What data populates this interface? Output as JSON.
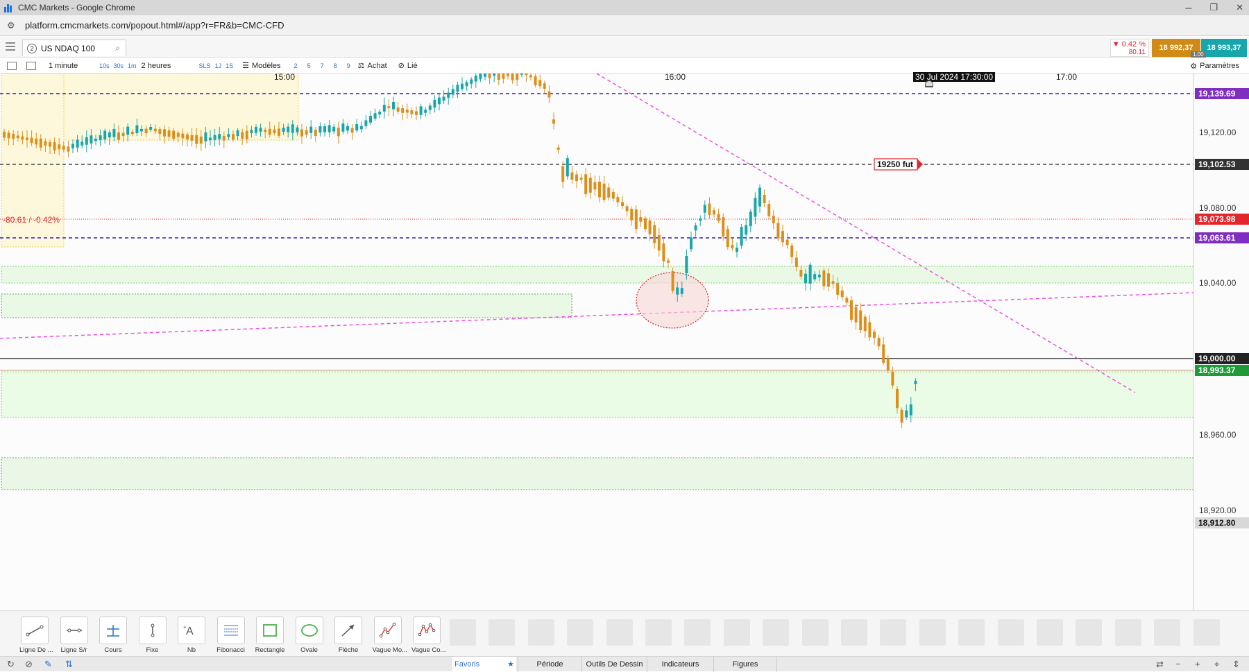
{
  "window": {
    "title": "CMC Markets - Google Chrome",
    "minimize": "─",
    "restore": "❐",
    "close": "✕"
  },
  "address_bar": {
    "url": "platform.cmcmarkets.com/popout.html#/app?r=FR&b=CMC-CFD"
  },
  "instrument": {
    "tab_number": "2",
    "name": "US NDAQ 100",
    "change_pct": "▼ 0.42 %",
    "change_abs": "80.11",
    "sell_price": "18 992,37",
    "buy_price": "18 993,37",
    "spread": "1.00"
  },
  "toolbar": {
    "interval": "1 minute",
    "quick_intervals": [
      "10s",
      "30s",
      "1m"
    ],
    "range": "2 heures",
    "quick_ranges": [
      "SLS",
      "1J",
      "1S"
    ],
    "templates": "Modèles",
    "presets": [
      "2",
      "5",
      "7",
      "8",
      "9"
    ],
    "mode": "Achat",
    "link": "Lié",
    "settings": "Paramètres"
  },
  "chart": {
    "time_labels": [
      "15:00",
      "16:00",
      "17:00"
    ],
    "crosshair_time": "30 Jul 2024 17:30:00",
    "price_labels": [
      "19,120.00",
      "19,080.00",
      "19,040.00",
      "18,960.00",
      "18,920.00"
    ],
    "level_tags": [
      {
        "text": "19,139.69",
        "bg": "#7e2fc1"
      },
      {
        "text": "19,102.53",
        "bg": "#333333"
      },
      {
        "text": "19,073.98",
        "bg": "#e1262c"
      },
      {
        "text": "19,063.61",
        "bg": "#7e2fc1"
      },
      {
        "text": "19,000.00",
        "bg": "#222222"
      },
      {
        "text": "18,993.37",
        "bg": "#1e9b38"
      },
      {
        "text": "18,912.80",
        "bg": "#d8d8d8"
      }
    ],
    "annotation": "19250 fut",
    "change_label": "-80.61 / -0.42%",
    "colors": {
      "up": "#17a6ab",
      "down": "#dd8f1c",
      "trend": "#ee4fe0",
      "purple": "#3b19b0",
      "red": "#e1262c",
      "zone": "#e9f9e6"
    }
  },
  "drawing_tools": [
    {
      "label": "Ligne De ...",
      "icon": "trend-line-icon"
    },
    {
      "label": "Ligne S/r",
      "icon": "sr-line-icon"
    },
    {
      "label": "Cours",
      "icon": "price-line-icon"
    },
    {
      "label": "Fixe",
      "icon": "fixed-line-icon"
    },
    {
      "label": "Nb",
      "icon": "text-icon"
    },
    {
      "label": "Fibonacci",
      "icon": "fibonacci-icon"
    },
    {
      "label": "Rectangle",
      "icon": "rectangle-icon"
    },
    {
      "label": "Ovale",
      "icon": "oval-icon"
    },
    {
      "label": "Flèche",
      "icon": "arrow-icon"
    },
    {
      "label": "Vague Mo...",
      "icon": "wave-icon"
    },
    {
      "label": "Vague Co...",
      "icon": "wave-corrective-icon"
    }
  ],
  "bottom_tabs": [
    "Favoris",
    "Période",
    "Outils De Dessin",
    "Indicateurs",
    "Figures"
  ],
  "zoom_controls": [
    "−",
    "+"
  ]
}
